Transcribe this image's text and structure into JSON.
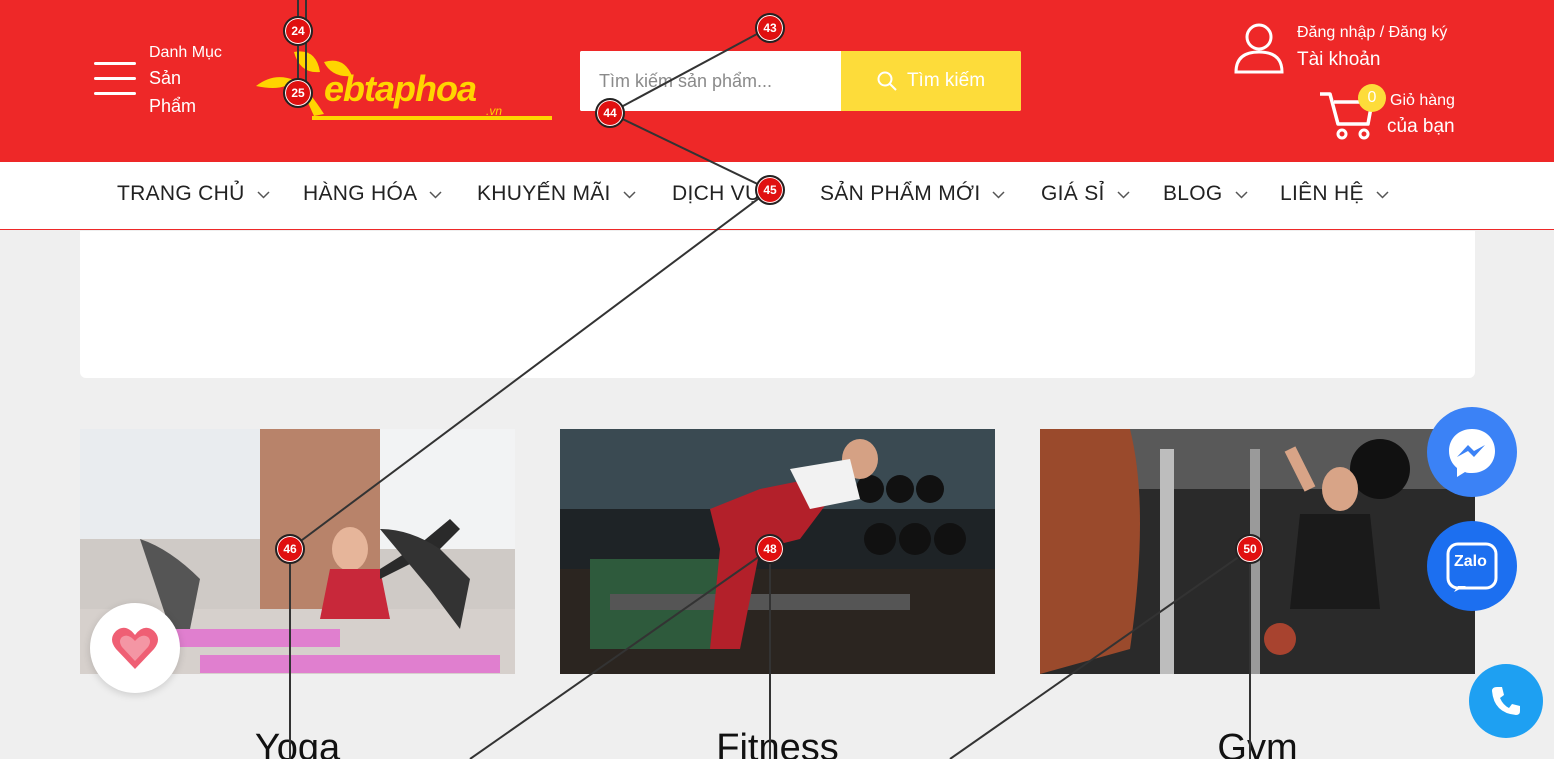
{
  "header": {
    "category": {
      "line1": "Danh Mục",
      "line2": "Sản",
      "line3": "Phẩm"
    },
    "logo": {
      "text": "ebtaphoa",
      "tld": ".vn"
    },
    "search": {
      "placeholder": "Tìm kiếm sản phẩm...",
      "button_label": "Tìm kiếm"
    },
    "account": {
      "top": "Đăng nhập / Đăng ký",
      "bottom": "Tài khoản"
    },
    "cart": {
      "count": "0",
      "top": "Giỏ hàng",
      "bottom": "của bạn"
    }
  },
  "nav": {
    "items": [
      {
        "label": "TRANG CHỦ"
      },
      {
        "label": "HÀNG HÓA"
      },
      {
        "label": "KHUYẾN MÃI"
      },
      {
        "label": "DỊCH VỤ"
      },
      {
        "label": "SẢN PHẨM MỚI"
      },
      {
        "label": "GIÁ SỈ"
      },
      {
        "label": "BLOG"
      },
      {
        "label": "LIÊN HỆ"
      }
    ]
  },
  "categories": [
    {
      "title": "Yoga"
    },
    {
      "title": "Fitness"
    },
    {
      "title": "Gym"
    }
  ],
  "floating": {
    "zalo_label": "Zalo"
  },
  "markers": [
    "24",
    "25",
    "43",
    "44",
    "45",
    "46",
    "48",
    "50"
  ],
  "colors": {
    "primary_red": "#ee2828",
    "accent_yellow": "#fddc3a",
    "messenger_blue": "#3b82f6",
    "zalo_blue": "#1c6ff0",
    "phone_blue": "#1ea0f2"
  }
}
